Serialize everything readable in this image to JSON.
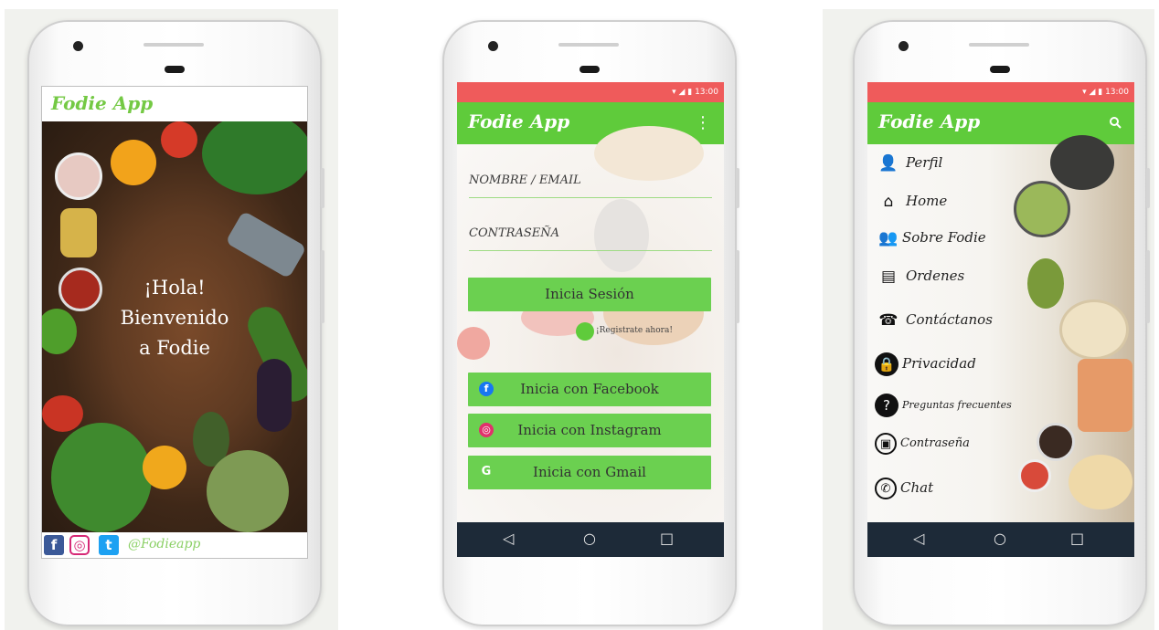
{
  "colors": {
    "brand_green": "#5fcb3b",
    "status_red": "#ef5b5b",
    "nav_dark": "#1d2a38"
  },
  "phone1": {
    "title": "Fodie App",
    "welcome": [
      "¡Hola!",
      "Bienvenido",
      "a Fodie"
    ],
    "social": {
      "facebook": "f",
      "instagram": "◎",
      "twitter": "t",
      "handle": "@Fodieapp"
    }
  },
  "phone2": {
    "status_time": "13:00",
    "title": "Fodie App",
    "more_icon": "⋮",
    "username_label": "NOMBRE / EMAIL",
    "password_label": "CONTRASEÑA",
    "login_button": "Inicia Sesión",
    "register_link": "¡Registrate ahora!",
    "facebook_button": "Inicia con Facebook",
    "instagram_button": "Inicia con Instagram",
    "gmail_button": "Inicia con Gmail",
    "nav": {
      "back": "◁",
      "home": "○",
      "recent": "□"
    }
  },
  "phone3": {
    "status_time": "13:00",
    "title": "Fodie App",
    "search_icon": "search-icon",
    "menu": [
      {
        "label": "Perfil",
        "icon": "user-check-icon"
      },
      {
        "label": "Home",
        "icon": "home-icon"
      },
      {
        "label": "Sobre Fodie",
        "icon": "group-icon"
      },
      {
        "label": "Ordenes",
        "icon": "clipboard-icon"
      },
      {
        "label": "Contáctanos",
        "icon": "phone-icon"
      },
      {
        "label": "Privacidad",
        "icon": "lock-icon"
      },
      {
        "label": "Preguntas frecuentes",
        "icon": "question-icon"
      },
      {
        "label": "Contraseña",
        "icon": "password-lock-icon"
      },
      {
        "label": "Chat",
        "icon": "whatsapp-icon"
      }
    ],
    "nav": {
      "back": "◁",
      "home": "○",
      "recent": "□"
    }
  }
}
